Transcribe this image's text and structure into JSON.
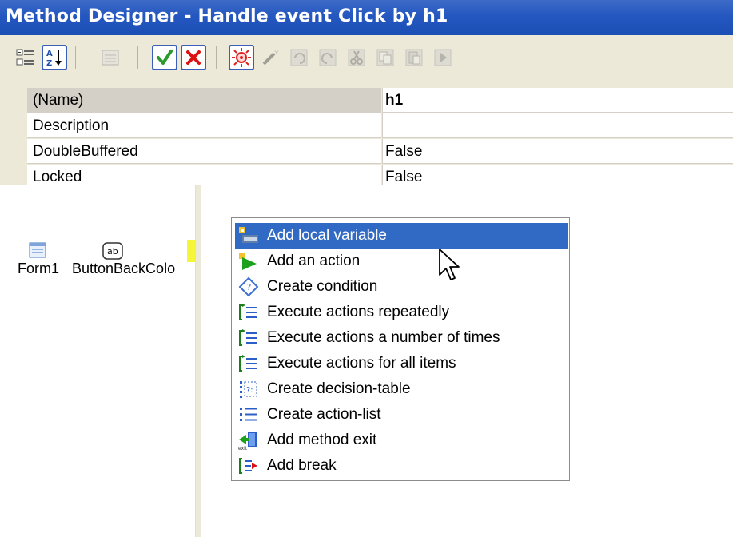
{
  "window": {
    "title": "Method Designer - Handle event Click by h1"
  },
  "toolbar": {
    "buttons": [
      {
        "icon": "categorized-icon",
        "enabled": true
      },
      {
        "icon": "sort-alphabetical-icon",
        "enabled": true
      },
      {
        "icon": "property-pages-icon",
        "enabled": false
      },
      {
        "icon": "ok-check-icon",
        "enabled": true
      },
      {
        "icon": "cancel-x-icon",
        "enabled": true
      },
      {
        "icon": "debug-icon",
        "enabled": true
      },
      {
        "icon": "magic-wand-icon",
        "enabled": false
      },
      {
        "icon": "undo-icon",
        "enabled": false
      },
      {
        "icon": "redo-icon",
        "enabled": false
      },
      {
        "icon": "cut-icon",
        "enabled": false
      },
      {
        "icon": "copy-icon",
        "enabled": false
      },
      {
        "icon": "paste-icon",
        "enabled": false
      },
      {
        "icon": "run-icon",
        "enabled": false
      }
    ]
  },
  "properties": [
    {
      "name": "(Name)",
      "value": "h1",
      "selected": true
    },
    {
      "name": "Description",
      "value": ""
    },
    {
      "name": "DoubleBuffered",
      "value": "False"
    },
    {
      "name": "Locked",
      "value": "False"
    }
  ],
  "components": [
    {
      "label": "Form1",
      "icon": "form-icon"
    },
    {
      "label": "ButtonBackColo",
      "icon": "button-ab-icon"
    }
  ],
  "context_menu": {
    "items": [
      {
        "label": "Add local variable",
        "icon": "local-variable-icon",
        "highlighted": true
      },
      {
        "label": "Add an action",
        "icon": "action-arrow-icon"
      },
      {
        "label": "Create condition",
        "icon": "condition-diamond-icon"
      },
      {
        "label": "Execute actions repeatedly",
        "icon": "loop-list-icon"
      },
      {
        "label": "Execute actions a number of times",
        "icon": "loop-list-icon"
      },
      {
        "label": "Execute actions for all items",
        "icon": "loop-list-icon"
      },
      {
        "label": "Create decision-table",
        "icon": "decision-table-icon"
      },
      {
        "label": "Create action-list",
        "icon": "action-list-icon"
      },
      {
        "label": "Add method exit",
        "icon": "method-exit-icon"
      },
      {
        "label": "Add break",
        "icon": "break-icon"
      }
    ]
  },
  "colors": {
    "title_bar": "#2457c0",
    "highlight": "#316ac5",
    "toolbar_bg": "#ece9d8"
  }
}
